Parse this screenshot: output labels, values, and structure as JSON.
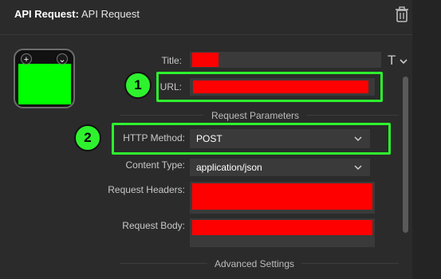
{
  "header": {
    "title": "API Request:",
    "value": "API Request",
    "trash_icon": "trash-icon"
  },
  "form": {
    "title_label": "Title:",
    "url_label": "URL:",
    "request_parameters_title": "Request Parameters",
    "http_method_label": "HTTP Method:",
    "http_method_value": "POST",
    "content_type_label": "Content Type:",
    "content_type_value": "application/json",
    "request_headers_label": "Request Headers:",
    "request_body_label": "Request Body:",
    "advanced_settings_title": "Advanced Settings",
    "text_style_glyph": "T"
  },
  "callouts": [
    {
      "number": "1"
    },
    {
      "number": "2"
    }
  ],
  "colors": {
    "highlight": "#2ef22e",
    "redacted": "#ff0000",
    "thumbnail": "#00ff00"
  }
}
